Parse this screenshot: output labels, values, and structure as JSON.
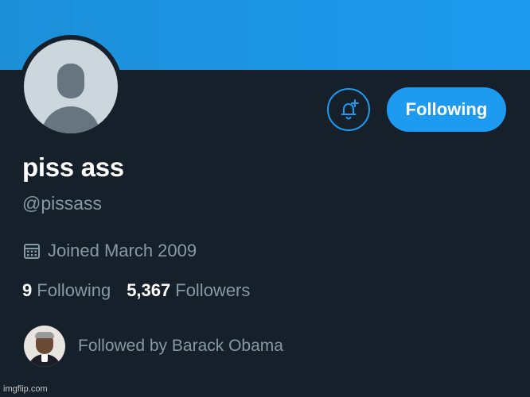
{
  "profile": {
    "name": "piss ass",
    "handle": "@pissass",
    "joined": "Joined March 2009",
    "following_count": "9",
    "following_label": "Following",
    "followers_count": "5,367",
    "followers_label": "Followers",
    "followed_by": "Followed by Barack Obama"
  },
  "actions": {
    "follow_button_label": "Following",
    "notify_icon": "bell-plus-icon"
  },
  "icons": {
    "joined": "calendar-icon"
  },
  "colors": {
    "banner": "#1d9bf0",
    "background": "#15202b",
    "accent": "#1d9bf0",
    "secondary_text": "#8899a6"
  },
  "watermark": "imgflip.com"
}
